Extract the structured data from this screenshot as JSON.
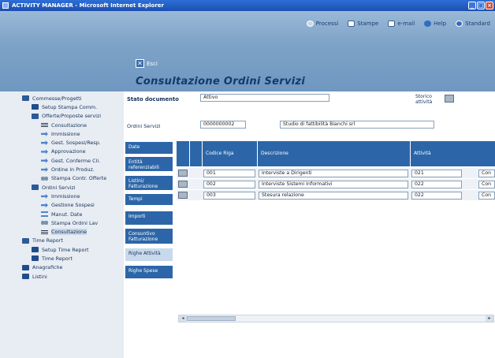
{
  "window": {
    "title": "ACTIVITY MANAGER - Microsoft Internet Explorer"
  },
  "toolbar": [
    {
      "label": "Processi",
      "icon": "process-icon"
    },
    {
      "label": "Stampe",
      "icon": "print-icon"
    },
    {
      "label": "e-mail",
      "icon": "mail-icon"
    },
    {
      "label": "Help",
      "icon": "help-icon"
    },
    {
      "label": "Standard",
      "icon": "standard-icon"
    }
  ],
  "header": {
    "esci_label": "Esci",
    "page_title": "Consultazione Ordini Servizi"
  },
  "sidebar": {
    "items": [
      {
        "label": "Commesse/Progetti",
        "icon": "folder-open-icon",
        "indent": 0
      },
      {
        "label": "Setup Stampa Comm.",
        "icon": "folder-icon",
        "indent": 1
      },
      {
        "label": "Offerte/Proposte servizi",
        "icon": "folder-open-icon",
        "indent": 1
      },
      {
        "label": "Consultazione",
        "icon": "list-icon",
        "indent": 2
      },
      {
        "label": "Immissione",
        "icon": "arrow-icon",
        "indent": 2
      },
      {
        "label": "Gest. Sospesi/Resp.",
        "icon": "arrow-icon",
        "indent": 2
      },
      {
        "label": "Approvazione",
        "icon": "arrow-icon",
        "indent": 2
      },
      {
        "label": "Gest. Conferme Cli.",
        "icon": "arrow-icon",
        "indent": 2
      },
      {
        "label": "Ordine in Produz.",
        "icon": "arrow-icon",
        "indent": 2
      },
      {
        "label": "Stampa Contr. Offerte",
        "icon": "glasses-icon",
        "indent": 2
      },
      {
        "label": "Ordini Servizi",
        "icon": "folder-open-icon",
        "indent": 1
      },
      {
        "label": "Immissione",
        "icon": "arrow-icon",
        "indent": 2
      },
      {
        "label": "Gestione Sospesi",
        "icon": "arrow-icon",
        "indent": 2
      },
      {
        "label": "Manut. Date",
        "icon": "double-arrow-icon",
        "indent": 2
      },
      {
        "label": "Stampa Ordini Lav",
        "icon": "glasses-icon",
        "indent": 2
      },
      {
        "label": "Consultazione",
        "icon": "list-icon",
        "indent": 2,
        "active": true
      },
      {
        "label": "Time Report",
        "icon": "folder-open-icon",
        "indent": 0
      },
      {
        "label": "Setup Time Report",
        "icon": "folder-icon",
        "indent": 1
      },
      {
        "label": "Time Report",
        "icon": "folder-icon",
        "indent": 1
      },
      {
        "label": "Anagrafiche",
        "icon": "folder-icon",
        "indent": 0
      },
      {
        "label": "Listini",
        "icon": "folder-icon",
        "indent": 0
      }
    ]
  },
  "form": {
    "stato_label": "Stato documento",
    "stato_value": "Attivo",
    "storico_label": "Storico attività",
    "ordini_label": "Ordini Servizi",
    "ordini_code": "0000000002",
    "ordini_desc": "Studio di fattibilità Bianchi srl"
  },
  "tabs": [
    {
      "label": "Date"
    },
    {
      "label": "Entità referenziabili"
    },
    {
      "label": "Listini/ Fatturazione"
    },
    {
      "label": "Tempi"
    },
    {
      "label": "Importi"
    },
    {
      "label": "Consuntivo Fatturazione"
    },
    {
      "label": "Righe Attività",
      "selected": true
    },
    {
      "label": "Righe Spese"
    }
  ],
  "grid": {
    "columns": [
      "Codice Riga",
      "Descrizione",
      "Attività"
    ],
    "rows": [
      {
        "codice": "001",
        "descrizione": "Interviste a Dirigenti",
        "attivita": "021",
        "extra": "Con"
      },
      {
        "codice": "002",
        "descrizione": "Interviste Sistemi Informativi",
        "attivita": "022",
        "extra": "Con"
      },
      {
        "codice": "003",
        "descrizione": "Stesura relazione",
        "attivita": "022",
        "extra": "Con"
      }
    ]
  }
}
